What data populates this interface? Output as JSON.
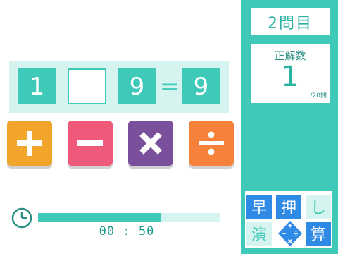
{
  "equation": {
    "first_operand": "1",
    "blank": "",
    "second_operand": "9",
    "equals": "=",
    "result": "9"
  },
  "operators": [
    {
      "name": "plus",
      "color": "#f2a52b"
    },
    {
      "name": "minus",
      "color": "#ef5a7a"
    },
    {
      "name": "times",
      "color": "#7a4f9c"
    },
    {
      "name": "divide",
      "color": "#f5813a"
    }
  ],
  "timer": {
    "display": "00 : 50",
    "remaining_fraction": 0.68
  },
  "panel": {
    "question_label": "2問目",
    "score_label": "正解数",
    "score_value": "1",
    "score_total": "/20問"
  },
  "logo": {
    "chars": [
      "早",
      "押",
      "し",
      "演",
      "算"
    ]
  },
  "colors": {
    "accent": "#40c9b8",
    "accent_light": "#d5f4f0",
    "logo_blue": "#2f8ae6"
  }
}
